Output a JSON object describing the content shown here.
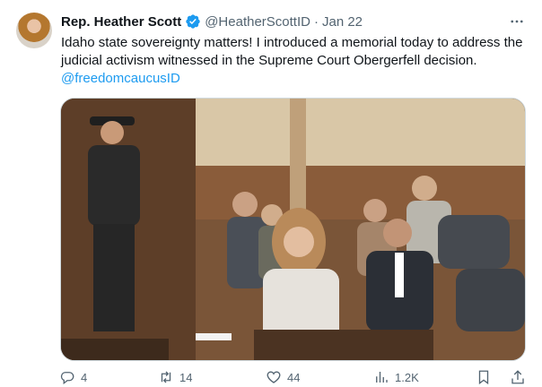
{
  "author": {
    "name": "Rep. Heather Scott",
    "handle": "@HeatherScottID",
    "separator": "·",
    "date": "Jan 22",
    "verified": true
  },
  "tweet": {
    "text": "Idaho state sovereignty matters!  I introduced a memorial today to address the judicial activism witnessed in the Supreme Court Obergerfell decision.",
    "mention": "@freedomcaucusID"
  },
  "actions": {
    "replies": "4",
    "retweets": "14",
    "likes": "44",
    "views": "1.2K"
  },
  "icons": {
    "verified": "verified-badge-icon",
    "more": "more-options-icon",
    "reply": "reply-icon",
    "retweet": "retweet-icon",
    "like": "heart-icon",
    "views": "views-chart-icon",
    "bookmark": "bookmark-icon",
    "share": "share-icon"
  },
  "colors": {
    "accent": "#1d9bf0",
    "muted": "#536471",
    "text": "#0f1419"
  }
}
